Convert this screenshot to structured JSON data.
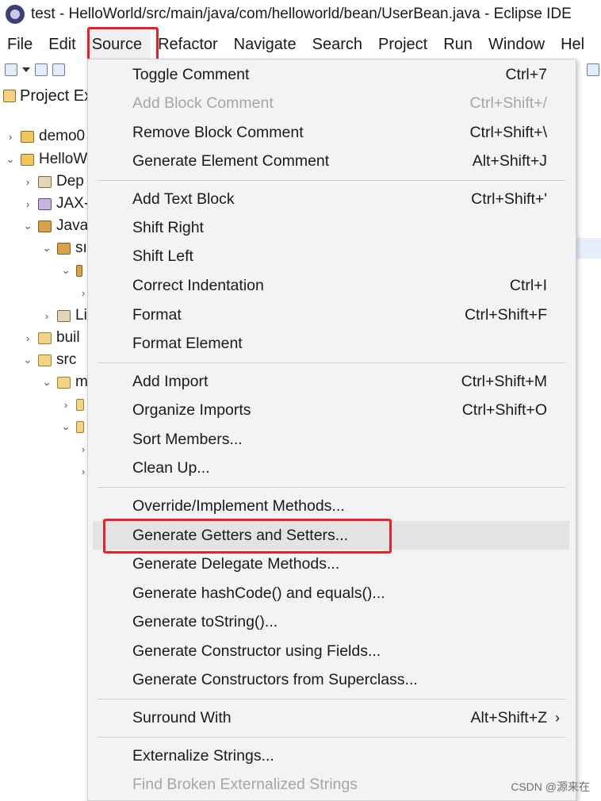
{
  "window": {
    "title": "test - HelloWorld/src/main/java/com/helloworld/bean/UserBean.java - Eclipse IDE"
  },
  "menubar": [
    "File",
    "Edit",
    "Source",
    "Refactor",
    "Navigate",
    "Search",
    "Project",
    "Run",
    "Window",
    "Hel"
  ],
  "panel": {
    "title": "Project Ex"
  },
  "tree": [
    "demo0",
    "HelloW",
    "Dep",
    "JAX-",
    "Java",
    "sı",
    "",
    "",
    "Li",
    "buil",
    "src",
    "m",
    "",
    "",
    "",
    ""
  ],
  "menu": {
    "groups": [
      [
        {
          "label": "Toggle Comment",
          "shortcut": "Ctrl+7"
        },
        {
          "label": "Add Block Comment",
          "shortcut": "Ctrl+Shift+/",
          "disabled": true
        },
        {
          "label": "Remove Block Comment",
          "shortcut": "Ctrl+Shift+\\"
        },
        {
          "label": "Generate Element Comment",
          "shortcut": "Alt+Shift+J"
        }
      ],
      [
        {
          "label": "Add Text Block",
          "shortcut": "Ctrl+Shift+'"
        },
        {
          "label": "Shift Right",
          "shortcut": ""
        },
        {
          "label": "Shift Left",
          "shortcut": ""
        },
        {
          "label": "Correct Indentation",
          "shortcut": "Ctrl+I"
        },
        {
          "label": "Format",
          "shortcut": "Ctrl+Shift+F"
        },
        {
          "label": "Format Element",
          "shortcut": ""
        }
      ],
      [
        {
          "label": "Add Import",
          "shortcut": "Ctrl+Shift+M"
        },
        {
          "label": "Organize Imports",
          "shortcut": "Ctrl+Shift+O"
        },
        {
          "label": "Sort Members...",
          "shortcut": ""
        },
        {
          "label": "Clean Up...",
          "shortcut": ""
        }
      ],
      [
        {
          "label": "Override/Implement Methods...",
          "shortcut": ""
        },
        {
          "label": "Generate Getters and Setters...",
          "shortcut": "",
          "highlighted": true
        },
        {
          "label": "Generate Delegate Methods...",
          "shortcut": ""
        },
        {
          "label": "Generate hashCode() and equals()...",
          "shortcut": ""
        },
        {
          "label": "Generate toString()...",
          "shortcut": ""
        },
        {
          "label": "Generate Constructor using Fields...",
          "shortcut": ""
        },
        {
          "label": "Generate Constructors from Superclass...",
          "shortcut": ""
        }
      ],
      [
        {
          "label": "Surround With",
          "shortcut": "Alt+Shift+Z",
          "submenu": true
        }
      ],
      [
        {
          "label": "Externalize Strings...",
          "shortcut": ""
        },
        {
          "label": "Find Broken Externalized Strings",
          "shortcut": "",
          "disabled": true
        }
      ]
    ]
  },
  "watermark": "CSDN @源来在",
  "colors": {
    "highlight_box": "#e8202a",
    "menu_bg": "#f3f3f3",
    "hover_bg": "#e3e3e3",
    "disabled_text": "#a6a6a6"
  }
}
